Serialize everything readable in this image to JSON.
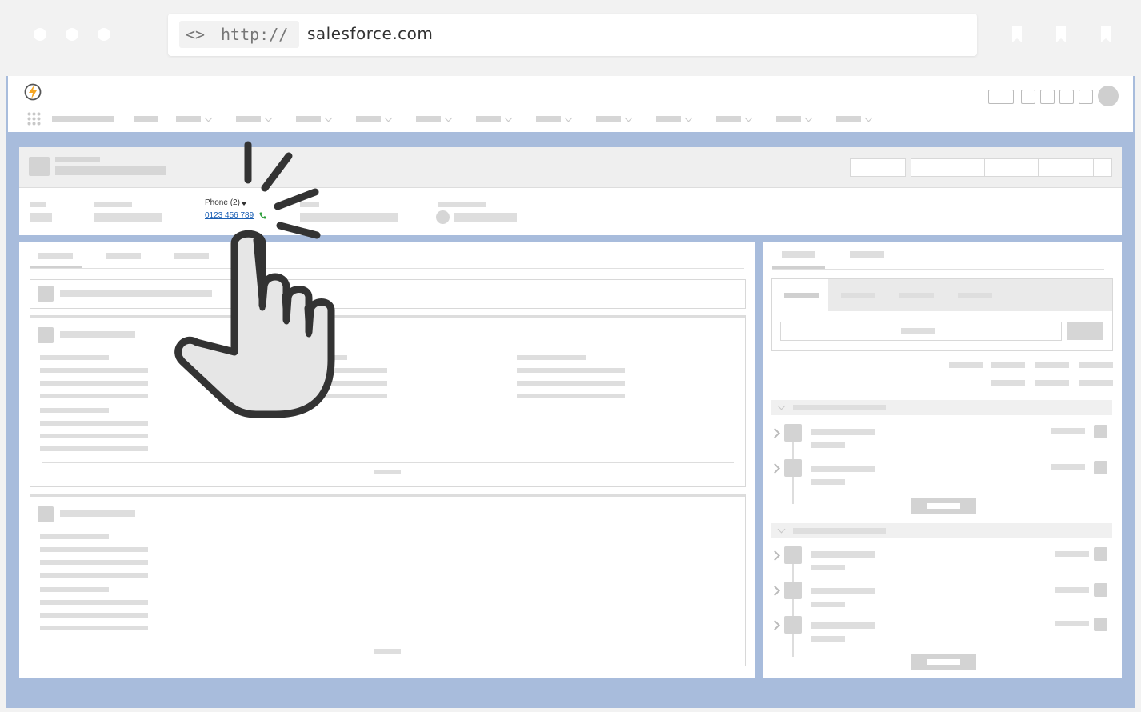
{
  "browser": {
    "url_protocol_icon": "<>",
    "url_protocol": "http://",
    "url_domain": "salesforce.com",
    "window_buttons": [
      "close-dot",
      "minimize-dot",
      "maximize-dot"
    ],
    "bookmark_icons": 3
  },
  "app": {
    "logo_icon": "lightning-bolt-icon",
    "accent_color": "#f5a623",
    "background_color": "#a8bcdc"
  },
  "record": {
    "phone_label": "Phone (2)",
    "phone_number": "0123 456 789",
    "phone_icon_color": "#2e9e3c"
  },
  "overlay": {
    "icon": "pointing-hand-click-icon"
  }
}
